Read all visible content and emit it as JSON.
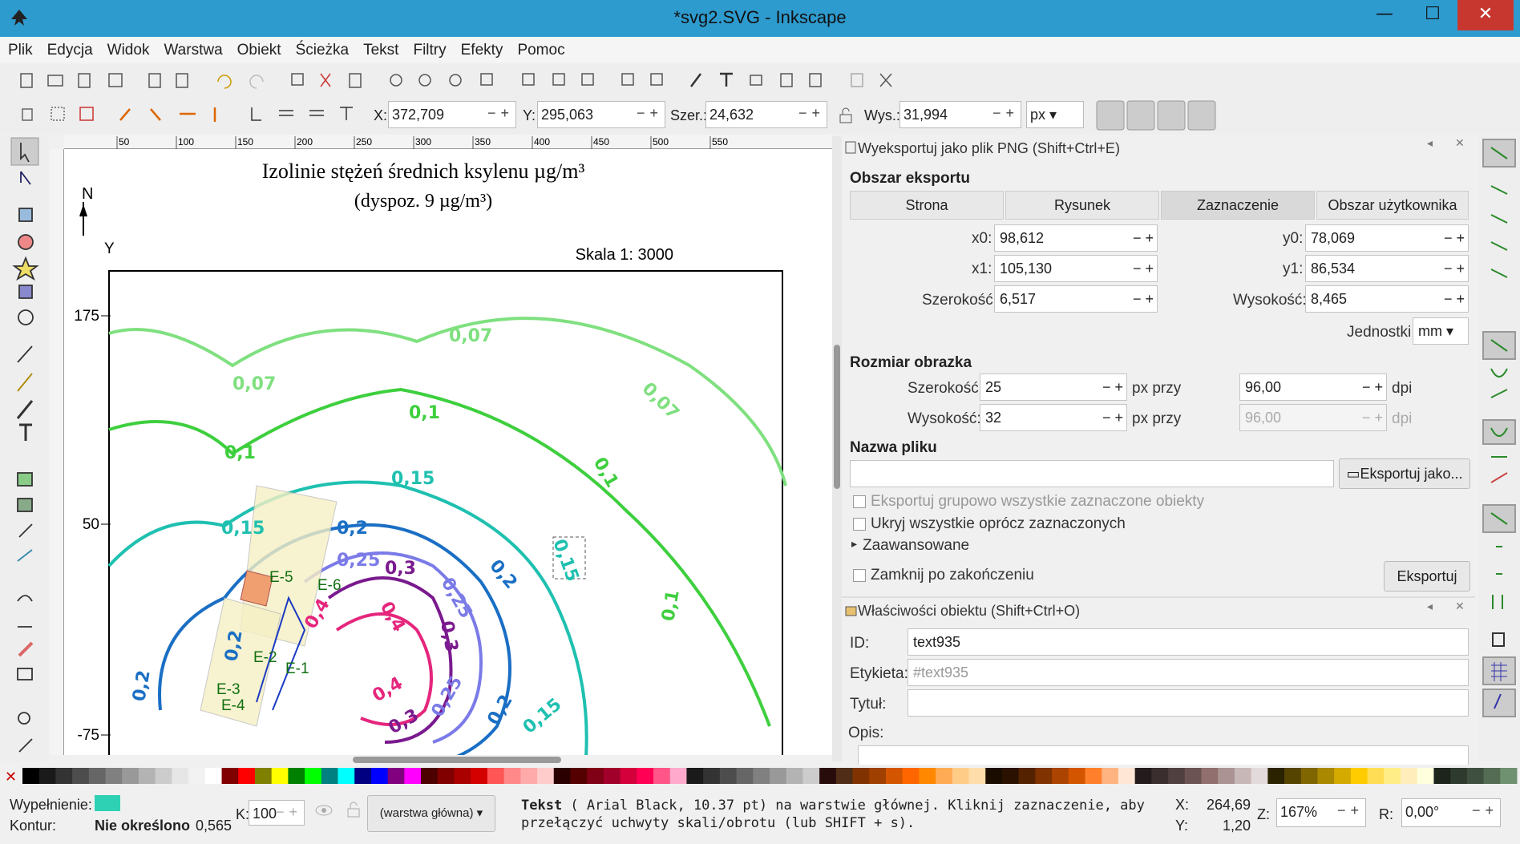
{
  "window": {
    "title": "*svg2.SVG - Inkscape",
    "min": "—",
    "max": "☐",
    "close": "✕"
  },
  "menu": [
    "Plik",
    "Edycja",
    "Widok",
    "Warstwa",
    "Obiekt",
    "Ścieżka",
    "Tekst",
    "Filtry",
    "Efekty",
    "Pomoc"
  ],
  "toolbar2": {
    "x_label": "X:",
    "x_value": "372,709",
    "y_label": "Y:",
    "y_value": "295,063",
    "w_label": "Szer.:",
    "w_value": "24,632",
    "h_label": "Wys.:",
    "h_value": "31,994",
    "unit": "px"
  },
  "ruler_ticks": [
    "50",
    "100",
    "150",
    "200",
    "250",
    "300",
    "350",
    "400",
    "450",
    "500",
    "550"
  ],
  "drawing": {
    "title": "Izolinie stężeń średnich ksylenu µg/m³",
    "subtitle": "(dyspoz. 9 µg/m³)",
    "north": "N",
    "y_axis": "Y",
    "scale": "Skala 1: 3000",
    "yticks": [
      "175",
      "50",
      "-75"
    ],
    "labels": [
      "0,07",
      "0,07",
      "0,07",
      "0,1",
      "0,1",
      "0,1",
      "0,1",
      "0,15",
      "0,15",
      "0,15",
      "0,15",
      "0,2",
      "0,2",
      "0,2",
      "0,2",
      "0,2",
      "0,25",
      "0,25",
      "0,25",
      "0,3",
      "0,3",
      "0,3",
      "0,4",
      "0,4",
      "0,4"
    ],
    "points": [
      "E-5",
      "E-6",
      "E-2",
      "E-1",
      "E-3",
      "E-4"
    ]
  },
  "export": {
    "header": "Wyeksportuj jako plik PNG (Shift+Ctrl+E)",
    "area_title": "Obszar eksportu",
    "tabs": [
      "Strona",
      "Rysunek",
      "Zaznaczenie",
      "Obszar użytkownika"
    ],
    "x0_label": "x0:",
    "x0": "98,612",
    "y0_label": "y0:",
    "y0": "78,069",
    "x1_label": "x1:",
    "x1": "105,130",
    "y1_label": "y1:",
    "y1": "86,534",
    "width_label": "Szerokość:",
    "width": "6,517",
    "height_label": "Wysokość:",
    "height": "8,465",
    "units_label": "Jednostki:",
    "units": "mm",
    "size_title": "Rozmiar obrazka",
    "img_w_label": "Szerokość:",
    "img_w": "25",
    "img_h_label": "Wysokość:",
    "img_h": "32",
    "px_at": "px przy",
    "dpi1": "96,00",
    "dpi2": "96,00",
    "dpi": "dpi",
    "filename_title": "Nazwa pliku",
    "export_as": "Eksportuj jako...",
    "batch": "Eksportuj grupowo wszystkie zaznaczone obiekty",
    "hide": "Ukryj wszystkie oprócz zaznaczonych",
    "advanced": "Zaawansowane",
    "close_after": "Zamknij po zakończeniu",
    "export_btn": "Eksportuj"
  },
  "props": {
    "header": "Właściwości obiektu (Shift+Ctrl+O)",
    "id_label": "ID:",
    "id": "text935",
    "label_label": "Etykieta:",
    "label_ph": "#text935",
    "title_label": "Tytuł:",
    "desc_label": "Opis:"
  },
  "status": {
    "fill_label": "Wypełnienie:",
    "stroke_label": "Kontur:",
    "stroke_value": "Nie określono",
    "stroke_width": "0,565",
    "opacity_label": "K:",
    "opacity": "100",
    "layer": "(warstwa główna)",
    "msg_bold": "Tekst",
    "msg": " ( Arial Black, 10.37 pt) na warstwie głównej. Kliknij zaznaczenie, aby przełączyć uchwyty skali/obrotu (lub SHIFT + s).",
    "x_label": "X:",
    "x": "264,69",
    "y_label": "Y:",
    "y": "1,20",
    "z_label": "Z:",
    "zoom": "167%",
    "r_label": "R:",
    "rot": "0,00°"
  },
  "colors": {
    "accent": "#2e9bcf",
    "fill_swatch": "#2fd1b5"
  }
}
